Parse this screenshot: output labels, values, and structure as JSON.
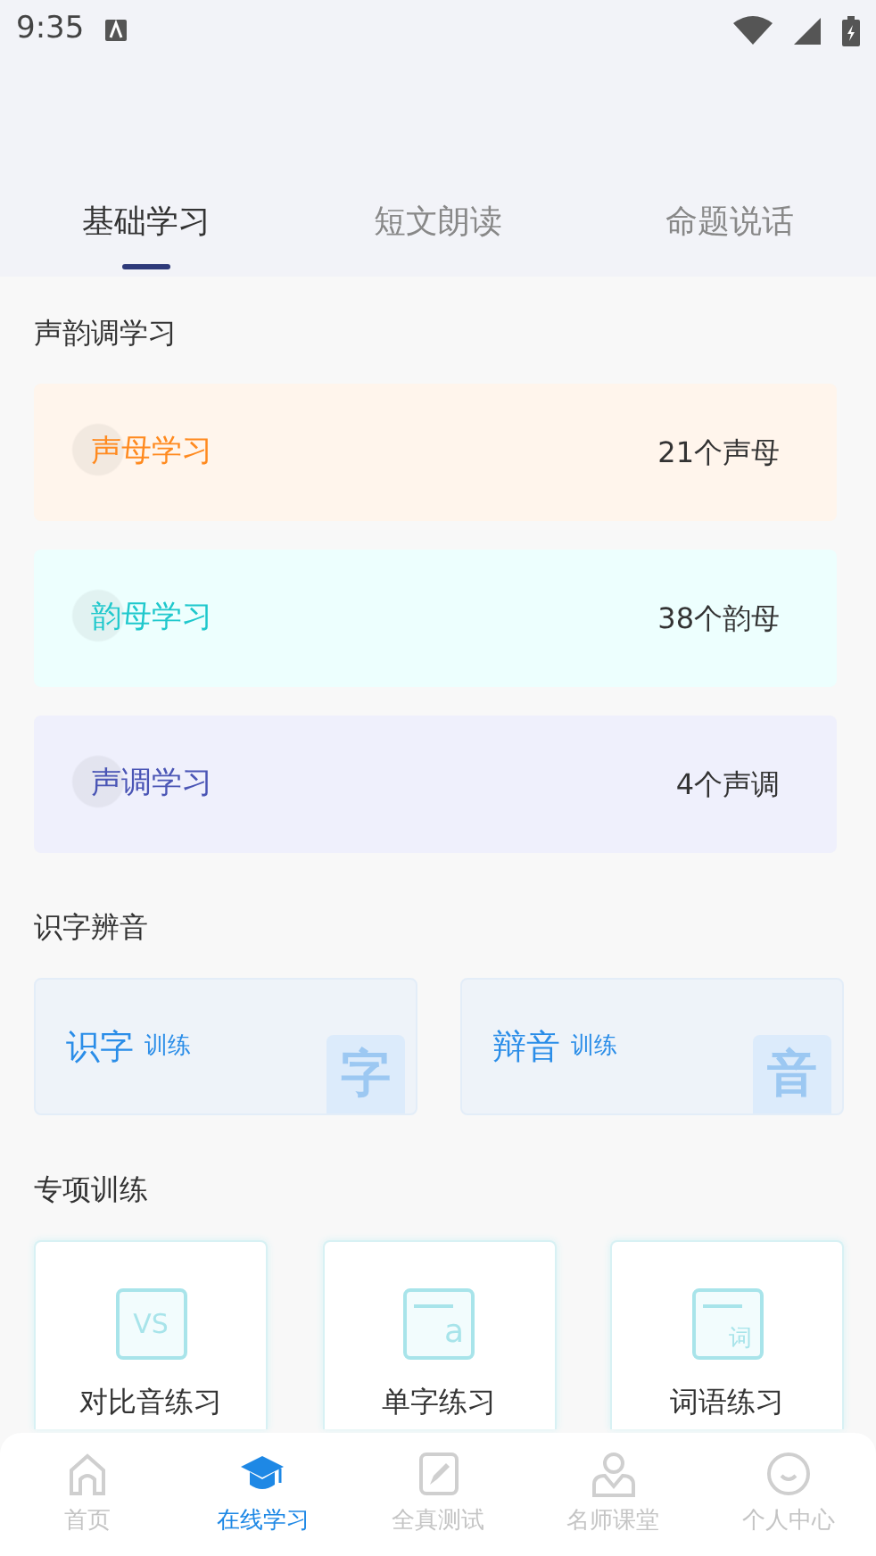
{
  "status_bar": {
    "time": "9:35"
  },
  "tabs": [
    {
      "label": "基础学习",
      "selected": true
    },
    {
      "label": "短文朗读",
      "selected": false
    },
    {
      "label": "命题说话",
      "selected": false
    }
  ],
  "sections": [
    {
      "title": "声韵调学习",
      "kind": "rows",
      "items": [
        {
          "label": "声母学习",
          "count": "21个声母",
          "color": "#ff8a1f"
        },
        {
          "label": "韵母学习",
          "count": "38个韵母",
          "color": "#1fc8cc"
        },
        {
          "label": "声调学习",
          "count": "4个声调",
          "color": "#4a55b5"
        }
      ]
    },
    {
      "title": "识字辨音",
      "kind": "pair",
      "items": [
        {
          "label": "识字",
          "sub": "训练",
          "badge": "字"
        },
        {
          "label": "辩音",
          "sub": "训练",
          "badge": "音"
        }
      ]
    },
    {
      "title": "专项训练",
      "kind": "tiles",
      "items": [
        {
          "label": "对比音练习",
          "kind": "vs",
          "icon_text": "VS"
        },
        {
          "label": "单字练习",
          "kind": "letter",
          "icon_text": "a"
        },
        {
          "label": "词语练习",
          "kind": "word",
          "icon_text": "词"
        }
      ]
    }
  ],
  "nav": [
    {
      "label": "首页",
      "kind": "home",
      "selected": false
    },
    {
      "label": "在线学习",
      "kind": "cap",
      "selected": true
    },
    {
      "label": "全真测试",
      "kind": "pen",
      "selected": false
    },
    {
      "label": "名师课堂",
      "kind": "teacher",
      "selected": false
    },
    {
      "label": "个人中心",
      "kind": "smile",
      "selected": false
    }
  ]
}
